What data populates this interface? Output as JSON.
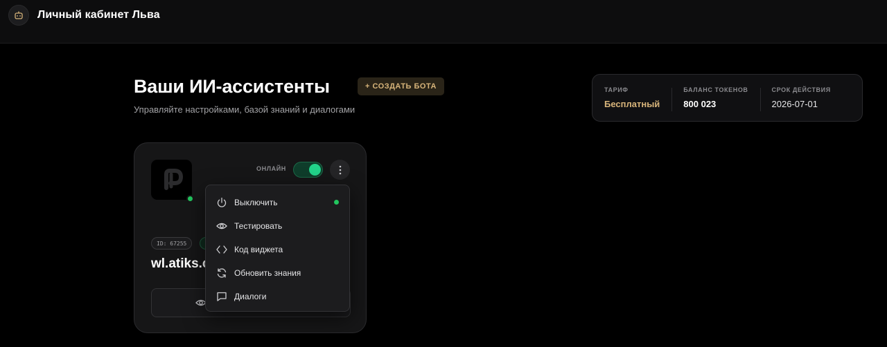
{
  "header": {
    "title": "Личный кабинет Льва"
  },
  "page": {
    "title": "Ваши ИИ-ассистенты",
    "create_button": "+ СОЗДАТЬ БОТА",
    "subtitle": "Управляйте настройками, базой знаний и диалогами"
  },
  "plan": {
    "tariff_label": "ТАРИФ",
    "tariff_value": "Бесплатный",
    "balance_label": "БАЛАНС ТОКЕНОВ",
    "balance_value": "800 023",
    "expiry_label": "СРОК ДЕЙСТВИЯ",
    "expiry_value": "2026-07-01"
  },
  "bot": {
    "status_label": "ОНЛАЙН",
    "online": true,
    "id_badge": "ID: 67255",
    "domain": "wl.atiks.c"
  },
  "menu": {
    "items": [
      {
        "label": "Выключить",
        "icon": "power-icon",
        "active": true
      },
      {
        "label": "Тестировать",
        "icon": "eye-icon"
      },
      {
        "label": "Код виджета",
        "icon": "code-icon"
      },
      {
        "label": "Обновить знания",
        "icon": "refresh-icon"
      },
      {
        "label": "Диалоги",
        "icon": "chat-icon"
      }
    ]
  },
  "colors": {
    "accent_gold": "#d7b47a",
    "online_green": "#22c55e",
    "background": "#000000"
  }
}
